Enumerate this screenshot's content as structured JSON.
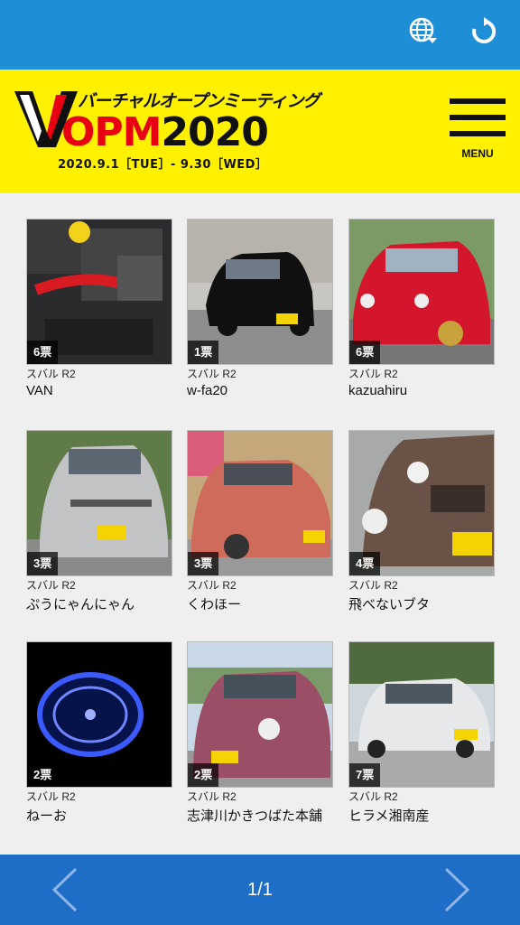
{
  "colors": {
    "header_blue": "#1e8fd6",
    "banner_yellow": "#fff100",
    "brand_red": "#e60012",
    "footer_blue": "#1e6ec7"
  },
  "header": {
    "icons": [
      "globe-icon",
      "refresh-icon"
    ]
  },
  "banner": {
    "logo_letter": "V",
    "subtitle": "バーチャルオープンミーティング",
    "opm": "OPM",
    "year": "2020",
    "dates": "2020.9.1［TUE］- 9.30［WED］",
    "menu_label": "MENU"
  },
  "entries": [
    {
      "votes": "6票",
      "model": "スバル R2",
      "owner": "VAN"
    },
    {
      "votes": "1票",
      "model": "スバル R2",
      "owner": "w-fa20"
    },
    {
      "votes": "6票",
      "model": "スバル R2",
      "owner": "kazuahiru"
    },
    {
      "votes": "3票",
      "model": "スバル R2",
      "owner": "ぷうにゃんにゃん"
    },
    {
      "votes": "3票",
      "model": "スバル R2",
      "owner": "くわほー"
    },
    {
      "votes": "4票",
      "model": "スバル R2",
      "owner": "飛べないブタ"
    },
    {
      "votes": "2票",
      "model": "スバル R2",
      "owner": "ねーお"
    },
    {
      "votes": "2票",
      "model": "スバル R2",
      "owner": "志津川かきつばた本舗"
    },
    {
      "votes": "7票",
      "model": "スバル R2",
      "owner": "ヒラメ湘南産"
    }
  ],
  "pagination": {
    "label": "1/1"
  }
}
